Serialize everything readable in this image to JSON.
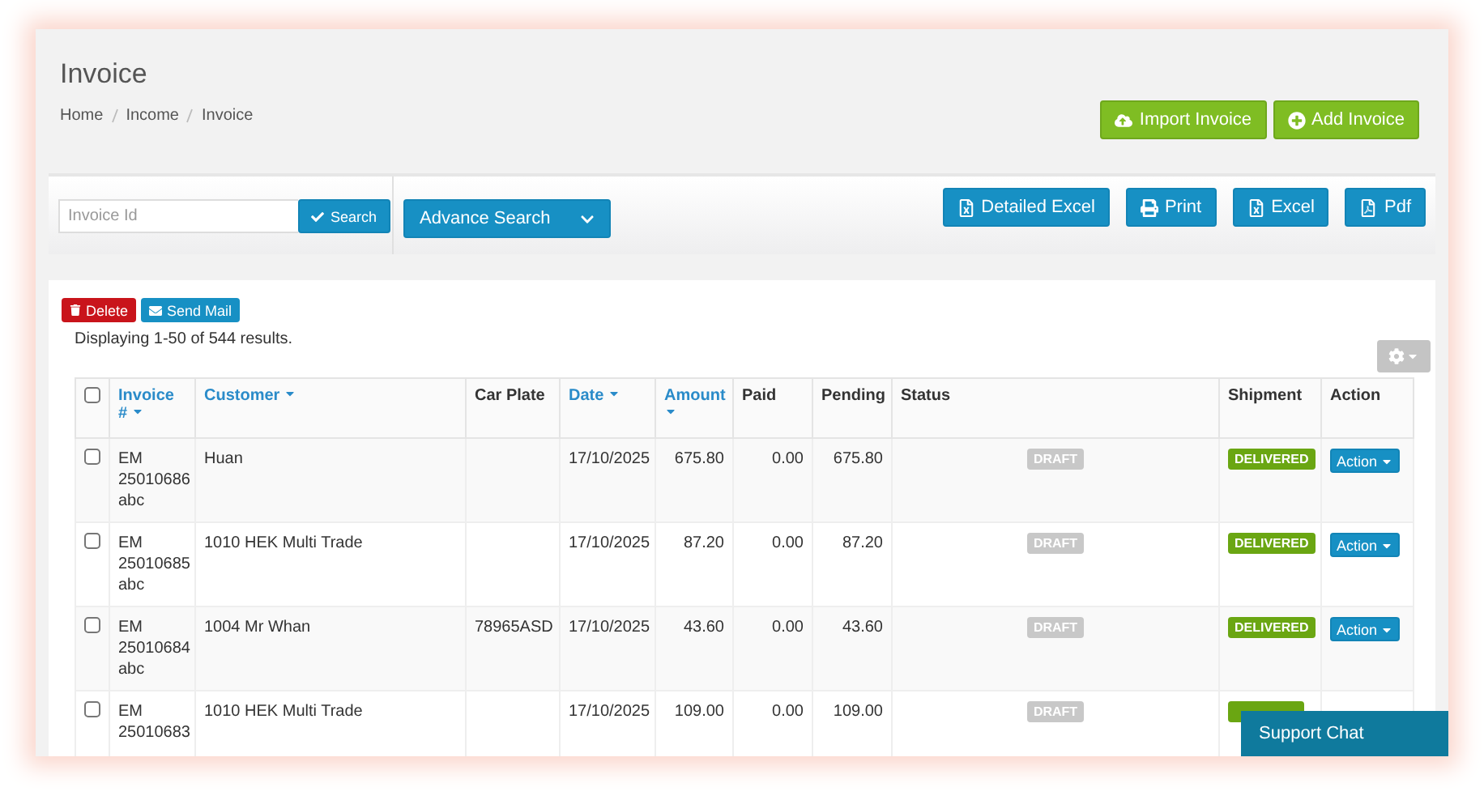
{
  "header": {
    "title": "Invoice",
    "breadcrumb": [
      "Home",
      "Income",
      "Invoice"
    ],
    "buttons": [
      {
        "label": "Import Invoice",
        "kind": "import"
      },
      {
        "label": "Add Invoice",
        "kind": "add"
      }
    ]
  },
  "toolbar": {
    "search": {
      "placeholder": "Invoice Id",
      "button": "Search"
    },
    "advance_search": "Advance Search",
    "exports": [
      {
        "label": "Detailed Excel",
        "kind": "excel"
      },
      {
        "label": "Print",
        "kind": "print"
      },
      {
        "label": "Excel",
        "kind": "excel"
      },
      {
        "label": "Pdf",
        "kind": "pdf"
      }
    ]
  },
  "bulk_actions": [
    {
      "label": "Delete",
      "kind": "delete"
    },
    {
      "label": "Send Mail",
      "kind": "mail"
    }
  ],
  "summary": "Displaying 1-50 of 544 results.",
  "table": {
    "all_checked": false,
    "columns": [
      {
        "label": "Invoice #",
        "sortable": true
      },
      {
        "label": "Customer",
        "sortable": true
      },
      {
        "label": "Car Plate",
        "sortable": false
      },
      {
        "label": "Date",
        "sortable": true
      },
      {
        "label": "Amount",
        "sortable": true
      },
      {
        "label": "Paid",
        "sortable": false
      },
      {
        "label": "Pending",
        "sortable": false
      },
      {
        "label": "Status",
        "sortable": false
      },
      {
        "label": "Shipment",
        "sortable": false
      },
      {
        "label": "Action",
        "sortable": false
      }
    ],
    "rows": [
      {
        "checked": false,
        "invoice": "EM 25010686 abc",
        "customer": "Huan",
        "car_plate": "",
        "date": "17/10/2025",
        "amount": "675.80",
        "paid": "0.00",
        "pending": "675.80",
        "status": "DRAFT",
        "shipment": "DELIVERED",
        "action": "Action"
      },
      {
        "checked": false,
        "invoice": "EM 25010685 abc",
        "customer": "1010 HEK Multi Trade",
        "car_plate": "",
        "date": "17/10/2025",
        "amount": "87.20",
        "paid": "0.00",
        "pending": "87.20",
        "status": "DRAFT",
        "shipment": "DELIVERED",
        "action": "Action"
      },
      {
        "checked": false,
        "invoice": "EM 25010684 abc",
        "customer": "1004 Mr Whan",
        "car_plate": "78965ASD",
        "date": "17/10/2025",
        "amount": "43.60",
        "paid": "0.00",
        "pending": "43.60",
        "status": "DRAFT",
        "shipment": "DELIVERED",
        "action": "Action"
      },
      {
        "checked": false,
        "invoice": "EM 25010683",
        "customer": "1010 HEK Multi Trade",
        "car_plate": "",
        "date": "17/10/2025",
        "amount": "109.00",
        "paid": "0.00",
        "pending": "109.00",
        "status": "DRAFT"
      }
    ]
  },
  "support_chat": "Support Chat"
}
